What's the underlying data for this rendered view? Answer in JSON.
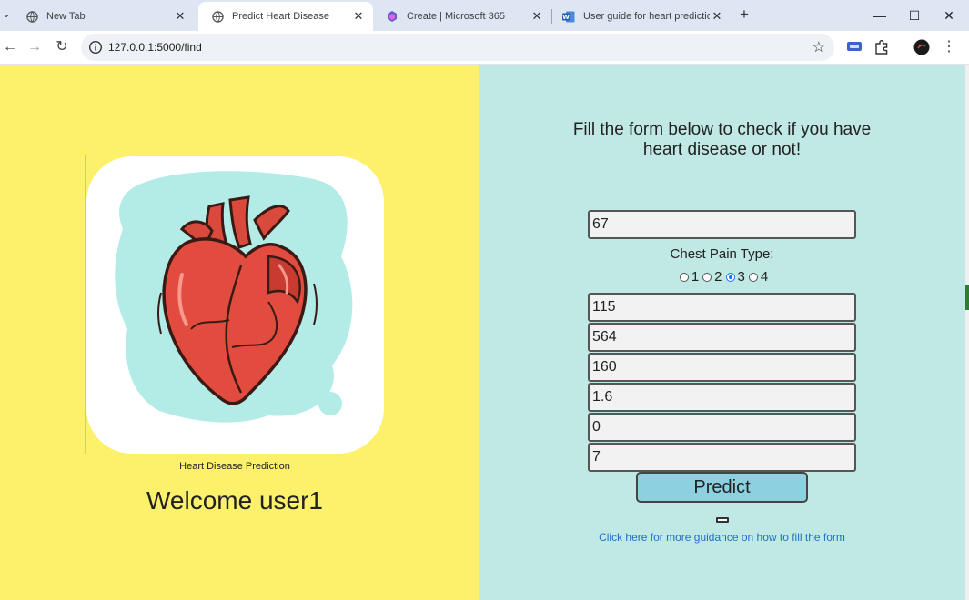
{
  "browser": {
    "tabs": [
      {
        "title": "New Tab",
        "close": "✕"
      },
      {
        "title": "Predict Heart Disease",
        "close": "✕"
      },
      {
        "title": "Create | Microsoft 365",
        "close": "✕"
      },
      {
        "title": "User guide for heart prediction",
        "close": "✕"
      }
    ],
    "new_tab": "+",
    "url": "127.0.0.1:5000/find",
    "window_controls": {
      "minimize": "—",
      "maximize": "☐",
      "close": "✕"
    },
    "nav": {
      "back": "←",
      "forward": "→",
      "reload": "↻"
    },
    "bookmark": "☆",
    "menu": "⋮",
    "tab_menu": "⌄",
    "icons": [
      "globe-icon",
      "info-icon",
      "star-icon",
      "extension-icon",
      "puzzle-icon",
      "profile-avatar",
      "kebab-menu-icon"
    ],
    "accent_color": "#1a73e8"
  },
  "left": {
    "background": "#fdf16c",
    "image_caption": "Heart Disease Prediction",
    "welcome": "Welcome user1"
  },
  "form": {
    "background": "#c0e9e5",
    "heading": "Fill the form below to check if you have heart disease or not!",
    "age": "67",
    "chest_pain_label": "Chest Pain Type:",
    "chest_pain_options": [
      "1",
      "2",
      "3",
      "4"
    ],
    "chest_pain_selected": "3",
    "fields": [
      "115",
      "564",
      "160",
      "1.6",
      "0",
      "7"
    ],
    "predict_label": "Predict",
    "guide_link": "Click here for more guidance on how to fill the form"
  }
}
